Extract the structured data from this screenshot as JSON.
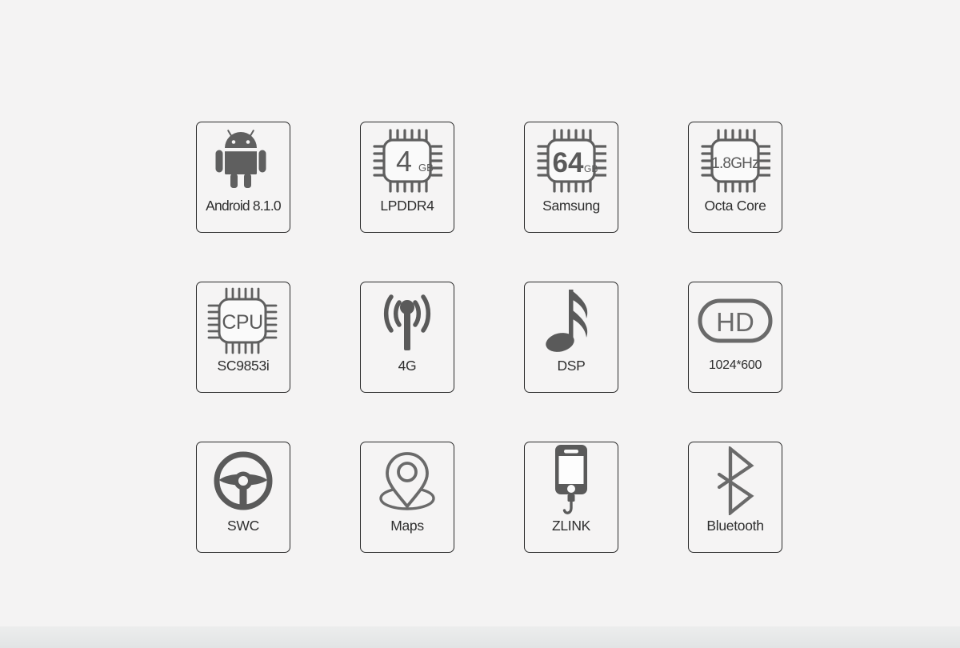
{
  "page": {
    "background_color": "#f4f3f3",
    "bottom_band_color": "#e4e6e7",
    "icon_color": "#5a5a5a",
    "border_color": "#2b2b2b",
    "text_color": "#2e2e2e"
  },
  "features": [
    {
      "icon": "android-robot-icon",
      "label": "Android 8.1.0",
      "label_style": "tight"
    },
    {
      "icon": "memory-chip-icon",
      "label": "LPDDR4",
      "chip_value": "4",
      "chip_unit": "GB"
    },
    {
      "icon": "storage-chip-icon",
      "label": "Samsung",
      "chip_value": "64",
      "chip_unit": "GB"
    },
    {
      "icon": "clockspeed-chip-icon",
      "label": "Octa Core",
      "chip_value": "1.8GHz"
    },
    {
      "icon": "cpu-chip-icon",
      "label": "SC9853i",
      "chip_value": "CPU"
    },
    {
      "icon": "antenna-signal-icon",
      "label": "4G"
    },
    {
      "icon": "music-note-icon",
      "label": "DSP"
    },
    {
      "icon": "hd-badge-icon",
      "label": "1024*600",
      "chip_value": "HD"
    },
    {
      "icon": "steering-wheel-icon",
      "label": "SWC"
    },
    {
      "icon": "map-pin-icon",
      "label": "Maps"
    },
    {
      "icon": "phone-cable-icon",
      "label": "ZLINK"
    },
    {
      "icon": "bluetooth-icon",
      "label": "Bluetooth"
    }
  ]
}
